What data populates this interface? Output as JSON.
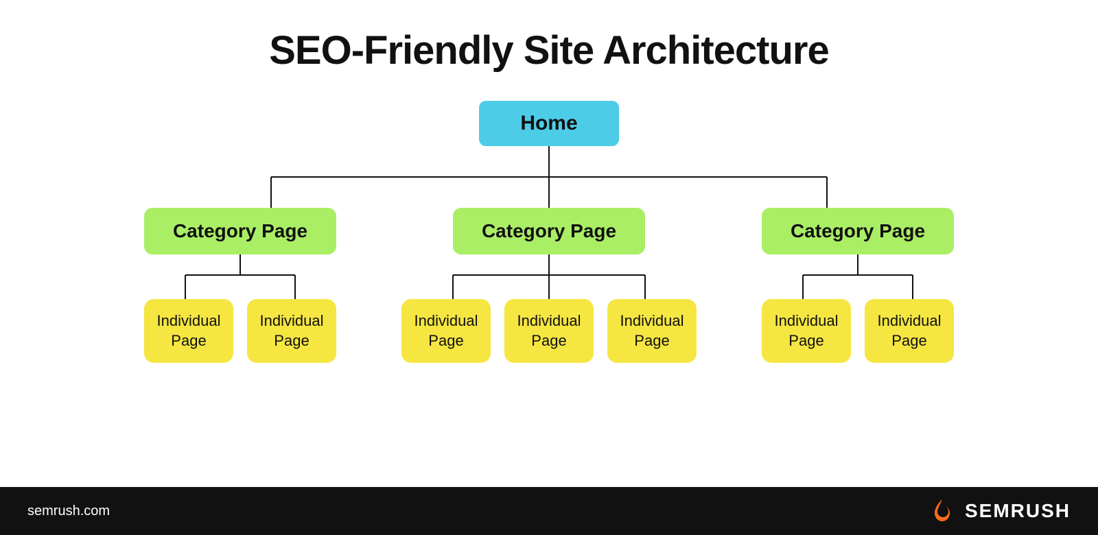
{
  "title": "SEO-Friendly Site Architecture",
  "home_label": "Home",
  "category_label": "Category Page",
  "individual_label": "Individual\nPage",
  "footer": {
    "url": "semrush.com",
    "brand": "SEMRUSH"
  },
  "colors": {
    "home_bg": "#4DCCE8",
    "category_bg": "#AAEE66",
    "individual_bg": "#F5E642",
    "footer_bg": "#111111",
    "line_color": "#111111"
  }
}
